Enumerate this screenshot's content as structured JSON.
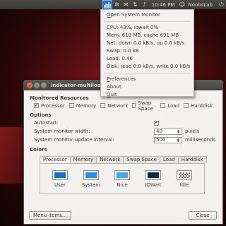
{
  "panel": {
    "clock": "10:46 PM",
    "user": "NoobsLab",
    "graph_levels": [
      0.4,
      0.7,
      0.5,
      0.9,
      0.6
    ]
  },
  "menu": {
    "items": [
      {
        "pre": "",
        "mn": "O",
        "post": "pen System Monitor"
      },
      {
        "pre": "CPU: 43%, iowait 0%",
        "mn": "",
        "post": ""
      },
      {
        "pre": "Mem: 618 MB, cache 691 MB",
        "mn": "",
        "post": ""
      },
      {
        "pre": "Net: down 0.0 kB/s, up 0.0 kB/s",
        "mn": "",
        "post": ""
      },
      {
        "pre": "Swap: 0.0 kB",
        "mn": "",
        "post": ""
      },
      {
        "pre": "Load: 0.46",
        "mn": "",
        "post": ""
      },
      {
        "pre": "Disk: read 0.0 kB/s, write 0.0 kB/s",
        "mn": "",
        "post": ""
      }
    ],
    "items2": [
      {
        "pre": "",
        "mn": "P",
        "post": "references"
      },
      {
        "pre": "",
        "mn": "A",
        "post": "bout"
      },
      {
        "pre": "",
        "mn": "Q",
        "post": "uit"
      }
    ]
  },
  "window": {
    "title": "indicator-multiload",
    "monitored_title": "Monitored Resources",
    "resources": [
      {
        "label": "Processor",
        "checked": true
      },
      {
        "label": "Memory",
        "checked": false
      },
      {
        "label": "Network",
        "checked": false
      },
      {
        "label": "Swap Space",
        "checked": false
      },
      {
        "label": "Load",
        "checked": false
      },
      {
        "label": "Harddisk",
        "checked": false
      }
    ],
    "options_title": "Options",
    "autostart_label": "Autostart:",
    "autostart_checked": true,
    "width_label": "System monitor width:",
    "width_value": "40",
    "width_unit": "pixels",
    "interval_label": "System monitor update interval:",
    "interval_value": "500",
    "interval_unit": "milliseconds",
    "colors_title": "Colors",
    "tabs": [
      "Processor",
      "Memory",
      "Network",
      "Swap Space",
      "Load",
      "Harddisk"
    ],
    "active_tab": 0,
    "swatches": [
      {
        "label": "User",
        "color": "#1b6fc4"
      },
      {
        "label": "System",
        "color": "#2a8ee8"
      },
      {
        "label": "Nice",
        "color": "#3fa8f5"
      },
      {
        "label": "IOWait",
        "color": "#0f2a40"
      },
      {
        "label": "Idle",
        "color": "pattern"
      }
    ],
    "menu_items_button": "Menu items...",
    "close_button": "Close"
  }
}
